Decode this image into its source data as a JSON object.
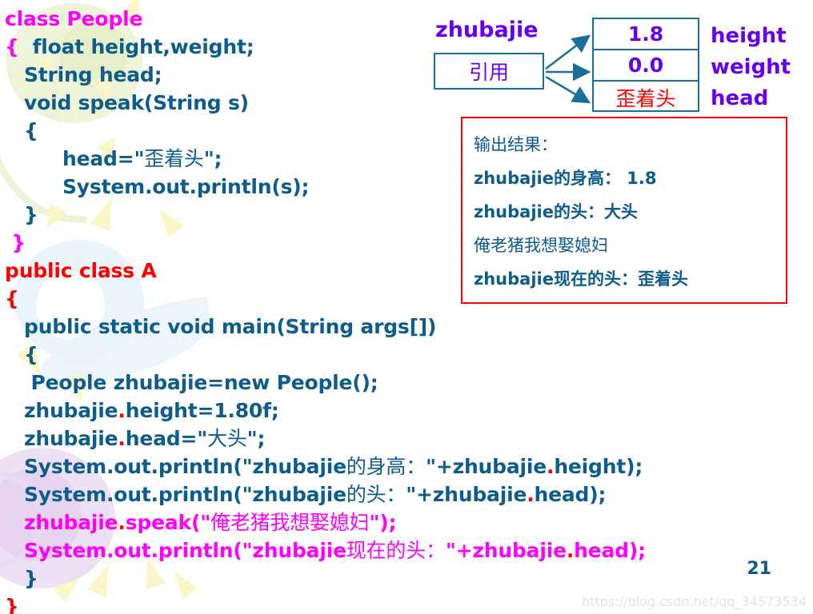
{
  "slide": {
    "page_number": "21",
    "watermark": "https://blog.csdn.net/qq_34573534"
  },
  "code": {
    "lines": [
      {
        "id": "l1",
        "indent": 0,
        "parts": [
          {
            "t": "class People",
            "c": "magenta"
          }
        ]
      },
      {
        "id": "l2",
        "indent": 0,
        "parts": [
          {
            "t": "{",
            "c": "magenta"
          },
          {
            "t": "  float height,weight;",
            "c": "blue"
          }
        ]
      },
      {
        "id": "l3",
        "indent": 1,
        "parts": [
          {
            "t": "String head;",
            "c": "blue"
          }
        ]
      },
      {
        "id": "l4",
        "indent": 1,
        "parts": [
          {
            "t": "void speak(String s)",
            "c": "blue"
          }
        ]
      },
      {
        "id": "l5",
        "indent": 1,
        "parts": [
          {
            "t": "{",
            "c": "blue"
          }
        ]
      },
      {
        "id": "l6",
        "indent": 3,
        "parts": [
          {
            "t": "head=\"",
            "c": "blue"
          },
          {
            "t": "歪着头",
            "c": "blue",
            "cjk": true
          },
          {
            "t": "\";",
            "c": "blue"
          }
        ]
      },
      {
        "id": "l7",
        "indent": 3,
        "parts": [
          {
            "t": "System.out.println(s);",
            "c": "blue"
          }
        ]
      },
      {
        "id": "l8",
        "indent": 1,
        "parts": [
          {
            "t": "}",
            "c": "blue"
          }
        ]
      },
      {
        "id": "l9",
        "indent": 0,
        "parts": [
          {
            "t": " }",
            "c": "magenta"
          }
        ]
      },
      {
        "id": "l10",
        "indent": 0,
        "parts": [
          {
            "t": "public class A",
            "c": "red"
          }
        ]
      },
      {
        "id": "l11",
        "indent": 0,
        "parts": [
          {
            "t": "{",
            "c": "red"
          }
        ]
      },
      {
        "id": "l12",
        "indent": 1,
        "parts": [
          {
            "t": "public static void main(String args[])",
            "c": "blue"
          }
        ]
      },
      {
        "id": "l13",
        "indent": 1,
        "parts": [
          {
            "t": "{",
            "c": "blue"
          }
        ]
      },
      {
        "id": "l14",
        "indent": 1,
        "parts": [
          {
            "t": " People zhubajie=new People();",
            "c": "blue"
          }
        ]
      },
      {
        "id": "l15",
        "indent": 1,
        "parts": [
          {
            "t": "zhubajie",
            "c": "blue"
          },
          {
            "t": ".",
            "c": "red"
          },
          {
            "t": "height=1.80f;",
            "c": "blue"
          }
        ]
      },
      {
        "id": "l16",
        "indent": 1,
        "parts": [
          {
            "t": "zhubajie",
            "c": "blue"
          },
          {
            "t": ".",
            "c": "red"
          },
          {
            "t": "head=\"",
            "c": "blue"
          },
          {
            "t": "大头",
            "c": "blue",
            "cjk": true
          },
          {
            "t": "\";",
            "c": "blue"
          }
        ]
      },
      {
        "id": "l17",
        "indent": 1,
        "parts": [
          {
            "t": "System.out.println(\"zhubajie",
            "c": "blue"
          },
          {
            "t": "的身高：",
            "c": "blue",
            "cjk": true
          },
          {
            "t": "\"+zhubajie",
            "c": "blue"
          },
          {
            "t": ".",
            "c": "red"
          },
          {
            "t": "height);",
            "c": "blue"
          }
        ]
      },
      {
        "id": "l18",
        "indent": 1,
        "parts": [
          {
            "t": "System.out.println(\"zhubajie",
            "c": "blue"
          },
          {
            "t": "的头：",
            "c": "blue",
            "cjk": true
          },
          {
            "t": "\"+zhubajie",
            "c": "blue"
          },
          {
            "t": ".",
            "c": "red"
          },
          {
            "t": "head);",
            "c": "blue"
          }
        ]
      },
      {
        "id": "l19",
        "indent": 1,
        "parts": [
          {
            "t": "zhubajie",
            "c": "magenta"
          },
          {
            "t": ".",
            "c": "red"
          },
          {
            "t": "speak(\"",
            "c": "magenta"
          },
          {
            "t": "俺老猪我想娶媳妇",
            "c": "magenta",
            "cjk": true
          },
          {
            "t": "\");",
            "c": "magenta"
          }
        ]
      },
      {
        "id": "l20",
        "indent": 1,
        "parts": [
          {
            "t": "System.out.println(\"zhubajie",
            "c": "magenta"
          },
          {
            "t": "现在的头：",
            "c": "magenta",
            "cjk": true
          },
          {
            "t": "\"+zhubajie",
            "c": "magenta"
          },
          {
            "t": ".",
            "c": "red"
          },
          {
            "t": "head);",
            "c": "magenta"
          }
        ]
      },
      {
        "id": "l21",
        "indent": 1,
        "parts": [
          {
            "t": "}",
            "c": "blue"
          }
        ]
      },
      {
        "id": "l22",
        "indent": 0,
        "parts": [
          {
            "t": "}",
            "c": "red"
          }
        ]
      }
    ]
  },
  "diagram": {
    "variable_label": "zhubajie",
    "reference_box_label": "引用",
    "object_fields": [
      {
        "value": "1.8",
        "name": "height"
      },
      {
        "value": "0.0",
        "name": "weight"
      },
      {
        "value": "歪着头",
        "name": "head"
      }
    ],
    "arrow_count": 3
  },
  "output_box": {
    "heading": "输出结果：",
    "lines": [
      "zhubajie的身高： 1.8",
      "zhubajie的头：大头",
      "俺老猪我想娶媳妇",
      "zhubajie现在的头：歪着头"
    ]
  },
  "colors": {
    "code_blue": "#0d5c8c",
    "code_magenta": "#ff00ff",
    "code_red": "#ff0000",
    "diagram_purple": "#6600ee",
    "box_border": "#1a6f96",
    "output_border": "#ff0000",
    "arrow": "#1a6f96"
  }
}
